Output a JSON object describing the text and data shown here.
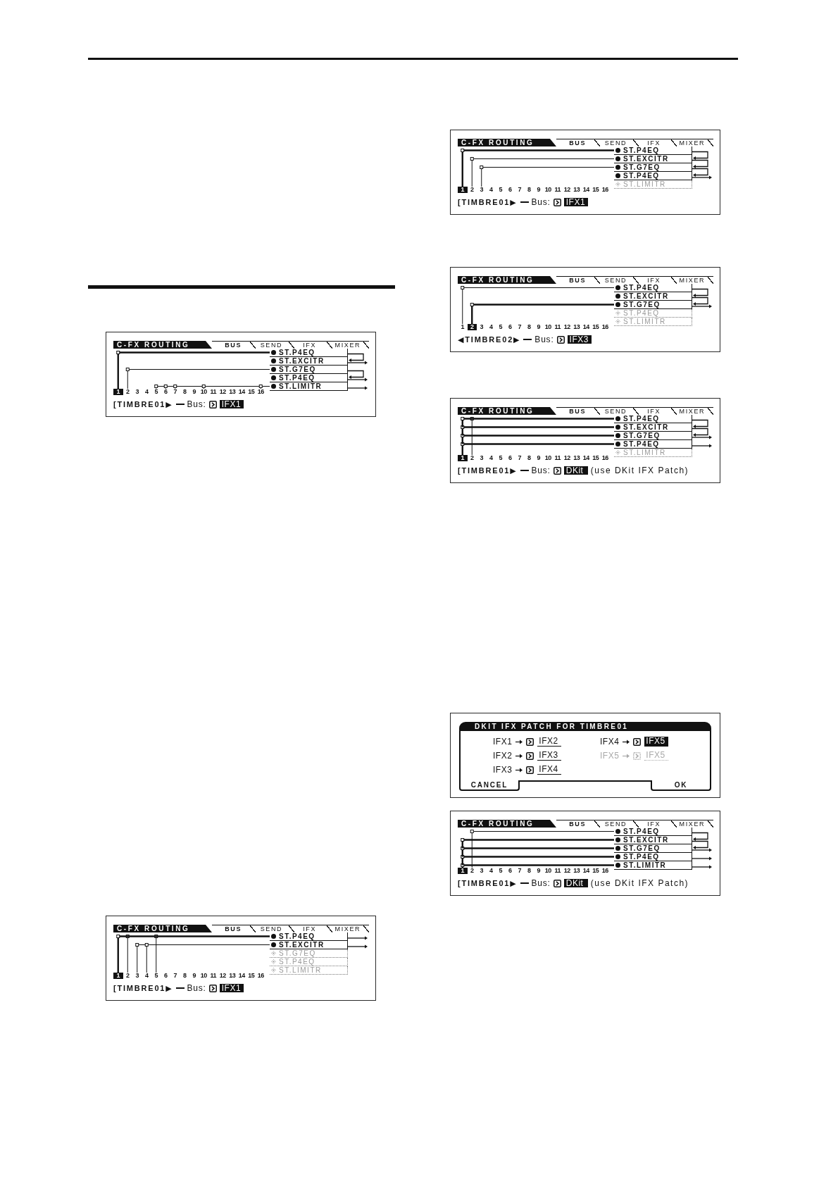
{
  "left_column": {
    "figures": [
      {
        "kind": "routing",
        "title": "C-FX ROUTING",
        "tabs": [
          {
            "label": "BUS",
            "selected": true
          },
          {
            "label": "SEND",
            "selected": false
          },
          {
            "label": "IFX",
            "selected": false
          },
          {
            "label": "MIXER",
            "selected": false
          }
        ],
        "effects": [
          {
            "name": "ST.P4EQ",
            "enabled": true,
            "chained": true
          },
          {
            "name": "ST.EXCITR",
            "enabled": true,
            "chained": false
          },
          {
            "name": "ST.G7EQ",
            "enabled": true,
            "chained": true
          },
          {
            "name": "ST.P4EQ",
            "enabled": true,
            "chained": false
          },
          {
            "name": "ST.LIMITR",
            "enabled": true,
            "chained": false
          }
        ],
        "timbres": [
          {
            "number": "1",
            "selected": true,
            "kind": "ifx1"
          },
          {
            "number": "2",
            "selected": false,
            "kind": "ifx3"
          },
          {
            "number": "3",
            "selected": false,
            "kind": "unrouted"
          },
          {
            "number": "4",
            "selected": false,
            "kind": "unrouted"
          },
          {
            "number": "5",
            "selected": false,
            "kind": "ifx5"
          },
          {
            "number": "6",
            "selected": false,
            "kind": "ifx5"
          },
          {
            "number": "7",
            "selected": false,
            "kind": "ifx5"
          },
          {
            "number": "8",
            "selected": false,
            "kind": "unrouted"
          },
          {
            "number": "9",
            "selected": false,
            "kind": "unrouted"
          },
          {
            "number": "10",
            "selected": false,
            "kind": "ifx5"
          },
          {
            "number": "11",
            "selected": false,
            "kind": "unrouted"
          },
          {
            "number": "12",
            "selected": false,
            "kind": "unrouted"
          },
          {
            "number": "13",
            "selected": false,
            "kind": "unrouted"
          },
          {
            "number": "14",
            "selected": false,
            "kind": "unrouted"
          },
          {
            "number": "15",
            "selected": false,
            "kind": "unrouted"
          },
          {
            "number": "16",
            "selected": false,
            "kind": "ifx5"
          }
        ],
        "timbre_selector": "[TIMBRE01▶",
        "bus_label": "Bus:",
        "bus": "IFX1"
      },
      {
        "kind": "routing",
        "title": "C-FX ROUTING",
        "tabs": [
          {
            "label": "BUS",
            "selected": true
          },
          {
            "label": "SEND",
            "selected": false
          },
          {
            "label": "IFX",
            "selected": false
          },
          {
            "label": "MIXER",
            "selected": false
          }
        ],
        "effects": [
          {
            "name": "ST.P4EQ",
            "enabled": true,
            "chained": false
          },
          {
            "name": "ST.EXCITR",
            "enabled": true,
            "chained": false
          },
          {
            "name": "ST.G7EQ",
            "enabled": false
          },
          {
            "name": "ST.P4EQ",
            "enabled": false
          },
          {
            "name": "ST.LIMITR",
            "enabled": false
          }
        ],
        "timbres": [
          {
            "number": "1",
            "selected": true,
            "kind": "ifx1"
          },
          {
            "number": "2",
            "selected": false,
            "kind": "ifx1"
          },
          {
            "number": "3",
            "selected": false,
            "kind": "ifx2"
          },
          {
            "number": "4",
            "selected": false,
            "kind": "ifx2"
          },
          {
            "number": "5",
            "selected": false,
            "kind": "ifx1"
          },
          {
            "number": "6",
            "selected": false,
            "kind": "unrouted"
          },
          {
            "number": "7",
            "selected": false,
            "kind": "unrouted"
          },
          {
            "number": "8",
            "selected": false,
            "kind": "unrouted"
          },
          {
            "number": "9",
            "selected": false,
            "kind": "unrouted"
          },
          {
            "number": "10",
            "selected": false,
            "kind": "unrouted"
          },
          {
            "number": "11",
            "selected": false,
            "kind": "unrouted"
          },
          {
            "number": "12",
            "selected": false,
            "kind": "unrouted"
          },
          {
            "number": "13",
            "selected": false,
            "kind": "unrouted"
          },
          {
            "number": "14",
            "selected": false,
            "kind": "unrouted"
          },
          {
            "number": "15",
            "selected": false,
            "kind": "unrouted"
          },
          {
            "number": "16",
            "selected": false,
            "kind": "unrouted"
          }
        ],
        "timbre_selector": "[TIMBRE01▶",
        "bus_label": "Bus:",
        "bus": "IFX1"
      }
    ]
  },
  "right_column": {
    "figures": [
      {
        "kind": "routing",
        "title": "C-FX ROUTING",
        "tabs": [
          {
            "label": "BUS",
            "selected": true
          },
          {
            "label": "SEND",
            "selected": false
          },
          {
            "label": "IFX",
            "selected": false
          },
          {
            "label": "MIXER",
            "selected": false
          }
        ],
        "effects": [
          {
            "name": "ST.P4EQ",
            "enabled": true,
            "chained": true
          },
          {
            "name": "ST.EXCITR",
            "enabled": true,
            "chained": true
          },
          {
            "name": "ST.G7EQ",
            "enabled": true,
            "chained": true
          },
          {
            "name": "ST.P4EQ",
            "enabled": true,
            "chained": false
          },
          {
            "name": "ST.LIMITR",
            "enabled": false
          }
        ],
        "timbres": [
          {
            "number": "1",
            "selected": true,
            "kind": "ifx1"
          },
          {
            "number": "2",
            "selected": false,
            "kind": "ifx2"
          },
          {
            "number": "3",
            "selected": false,
            "kind": "ifx3"
          },
          {
            "number": "4",
            "selected": false,
            "kind": "unrouted"
          },
          {
            "number": "5",
            "selected": false,
            "kind": "unrouted"
          },
          {
            "number": "6",
            "selected": false,
            "kind": "unrouted"
          },
          {
            "number": "7",
            "selected": false,
            "kind": "unrouted"
          },
          {
            "number": "8",
            "selected": false,
            "kind": "unrouted"
          },
          {
            "number": "9",
            "selected": false,
            "kind": "unrouted"
          },
          {
            "number": "10",
            "selected": false,
            "kind": "unrouted"
          },
          {
            "number": "11",
            "selected": false,
            "kind": "unrouted"
          },
          {
            "number": "12",
            "selected": false,
            "kind": "unrouted"
          },
          {
            "number": "13",
            "selected": false,
            "kind": "unrouted"
          },
          {
            "number": "14",
            "selected": false,
            "kind": "unrouted"
          },
          {
            "number": "15",
            "selected": false,
            "kind": "unrouted"
          },
          {
            "number": "16",
            "selected": false,
            "kind": "unrouted"
          }
        ],
        "timbre_selector": "[TIMBRE01▶",
        "bus_label": "Bus:",
        "bus": "IFX1"
      },
      {
        "kind": "routing",
        "title": "C-FX ROUTING",
        "tabs": [
          {
            "label": "BUS",
            "selected": true
          },
          {
            "label": "SEND",
            "selected": false
          },
          {
            "label": "IFX",
            "selected": false
          },
          {
            "label": "MIXER",
            "selected": false
          }
        ],
        "effects": [
          {
            "name": "ST.P4EQ",
            "enabled": true,
            "chained": true
          },
          {
            "name": "ST.EXCITR",
            "enabled": true,
            "chained": true
          },
          {
            "name": "ST.G7EQ",
            "enabled": true,
            "chained": false
          },
          {
            "name": "ST.P4EQ",
            "enabled": false
          },
          {
            "name": "ST.LIMITR",
            "enabled": false
          }
        ],
        "timbres": [
          {
            "number": "1",
            "selected": false,
            "kind": "ifx1"
          },
          {
            "number": "2",
            "selected": true,
            "kind": "ifx3"
          },
          {
            "number": "3",
            "selected": false,
            "kind": "unrouted"
          },
          {
            "number": "4",
            "selected": false,
            "kind": "unrouted"
          },
          {
            "number": "5",
            "selected": false,
            "kind": "unrouted"
          },
          {
            "number": "6",
            "selected": false,
            "kind": "unrouted"
          },
          {
            "number": "7",
            "selected": false,
            "kind": "unrouted"
          },
          {
            "number": "8",
            "selected": false,
            "kind": "unrouted"
          },
          {
            "number": "9",
            "selected": false,
            "kind": "unrouted"
          },
          {
            "number": "10",
            "selected": false,
            "kind": "unrouted"
          },
          {
            "number": "11",
            "selected": false,
            "kind": "unrouted"
          },
          {
            "number": "12",
            "selected": false,
            "kind": "unrouted"
          },
          {
            "number": "13",
            "selected": false,
            "kind": "unrouted"
          },
          {
            "number": "14",
            "selected": false,
            "kind": "unrouted"
          },
          {
            "number": "15",
            "selected": false,
            "kind": "unrouted"
          },
          {
            "number": "16",
            "selected": false,
            "kind": "unrouted"
          }
        ],
        "timbre_selector": "◀TIMBRE02▶",
        "bus_label": "Bus:",
        "bus": "IFX3"
      },
      {
        "kind": "routing",
        "title": "C-FX ROUTING",
        "tabs": [
          {
            "label": "BUS",
            "selected": true
          },
          {
            "label": "SEND",
            "selected": false
          },
          {
            "label": "IFX",
            "selected": false
          },
          {
            "label": "MIXER",
            "selected": false
          }
        ],
        "effects": [
          {
            "name": "ST.P4EQ",
            "enabled": true,
            "chained": true,
            "kit_input": true
          },
          {
            "name": "ST.EXCITR",
            "enabled": true,
            "chained": true,
            "kit_input": true
          },
          {
            "name": "ST.G7EQ",
            "enabled": true,
            "chained": false,
            "kit_input": true
          },
          {
            "name": "ST.P4EQ",
            "enabled": true,
            "chained": false,
            "kit_input": true
          },
          {
            "name": "ST.LIMITR",
            "enabled": false,
            "kit_input": false
          }
        ],
        "timbres": [
          {
            "number": "1",
            "selected": true,
            "kind": "dkit"
          },
          {
            "number": "2",
            "selected": false,
            "kind": "ifx1"
          },
          {
            "number": "3",
            "selected": false,
            "kind": "unrouted"
          },
          {
            "number": "4",
            "selected": false,
            "kind": "unrouted"
          },
          {
            "number": "5",
            "selected": false,
            "kind": "unrouted"
          },
          {
            "number": "6",
            "selected": false,
            "kind": "unrouted"
          },
          {
            "number": "7",
            "selected": false,
            "kind": "unrouted"
          },
          {
            "number": "8",
            "selected": false,
            "kind": "unrouted"
          },
          {
            "number": "9",
            "selected": false,
            "kind": "unrouted"
          },
          {
            "number": "10",
            "selected": false,
            "kind": "unrouted"
          },
          {
            "number": "11",
            "selected": false,
            "kind": "unrouted"
          },
          {
            "number": "12",
            "selected": false,
            "kind": "unrouted"
          },
          {
            "number": "13",
            "selected": false,
            "kind": "unrouted"
          },
          {
            "number": "14",
            "selected": false,
            "kind": "unrouted"
          },
          {
            "number": "15",
            "selected": false,
            "kind": "unrouted"
          },
          {
            "number": "16",
            "selected": false,
            "kind": "unrouted"
          }
        ],
        "timbre_selector": "[TIMBRE01▶",
        "bus_label": "Bus:",
        "bus": "DKit",
        "note": "(use DKit IFX Patch)"
      },
      {
        "kind": "dialog",
        "title": "DKIT IFX PATCH FOR TIMBRE01",
        "patches": [
          {
            "source": "IFX1",
            "target": "IFX2",
            "selected": false,
            "disabled": false
          },
          {
            "source": "IFX2",
            "target": "IFX3",
            "selected": false,
            "disabled": false
          },
          {
            "source": "IFX3",
            "target": "IFX4",
            "selected": false,
            "disabled": false
          },
          {
            "source": "IFX4",
            "target": "IFX5",
            "selected": true,
            "disabled": false
          },
          {
            "source": "IFX5",
            "target": "IFX5",
            "selected": false,
            "disabled": true
          }
        ],
        "buttons": [
          "CANCEL",
          "OK"
        ]
      },
      {
        "kind": "routing",
        "title": "C-FX ROUTING",
        "tabs": [
          {
            "label": "BUS",
            "selected": true
          },
          {
            "label": "SEND",
            "selected": false
          },
          {
            "label": "IFX",
            "selected": false
          },
          {
            "label": "MIXER",
            "selected": false
          }
        ],
        "effects": [
          {
            "name": "ST.P4EQ",
            "enabled": true,
            "chained": true,
            "kit_input": false
          },
          {
            "name": "ST.EXCITR",
            "enabled": true,
            "chained": true,
            "kit_input": true
          },
          {
            "name": "ST.G7EQ",
            "enabled": true,
            "chained": false,
            "kit_input": true
          },
          {
            "name": "ST.P4EQ",
            "enabled": true,
            "chained": false,
            "kit_input": true
          },
          {
            "name": "ST.LIMITR",
            "enabled": true,
            "chained": false,
            "kit_input": true
          }
        ],
        "timbres": [
          {
            "number": "1",
            "selected": true,
            "kind": "dkit"
          },
          {
            "number": "2",
            "selected": false,
            "kind": "ifx1"
          },
          {
            "number": "3",
            "selected": false,
            "kind": "unrouted"
          },
          {
            "number": "4",
            "selected": false,
            "kind": "unrouted"
          },
          {
            "number": "5",
            "selected": false,
            "kind": "unrouted"
          },
          {
            "number": "6",
            "selected": false,
            "kind": "unrouted"
          },
          {
            "number": "7",
            "selected": false,
            "kind": "unrouted"
          },
          {
            "number": "8",
            "selected": false,
            "kind": "unrouted"
          },
          {
            "number": "9",
            "selected": false,
            "kind": "unrouted"
          },
          {
            "number": "10",
            "selected": false,
            "kind": "unrouted"
          },
          {
            "number": "11",
            "selected": false,
            "kind": "unrouted"
          },
          {
            "number": "12",
            "selected": false,
            "kind": "unrouted"
          },
          {
            "number": "13",
            "selected": false,
            "kind": "unrouted"
          },
          {
            "number": "14",
            "selected": false,
            "kind": "unrouted"
          },
          {
            "number": "15",
            "selected": false,
            "kind": "unrouted"
          },
          {
            "number": "16",
            "selected": false,
            "kind": "unrouted"
          }
        ],
        "timbre_selector": "[TIMBRE01▶",
        "bus_label": "Bus:",
        "bus": "DKit",
        "note": "(use DKit IFX Patch)"
      }
    ]
  }
}
